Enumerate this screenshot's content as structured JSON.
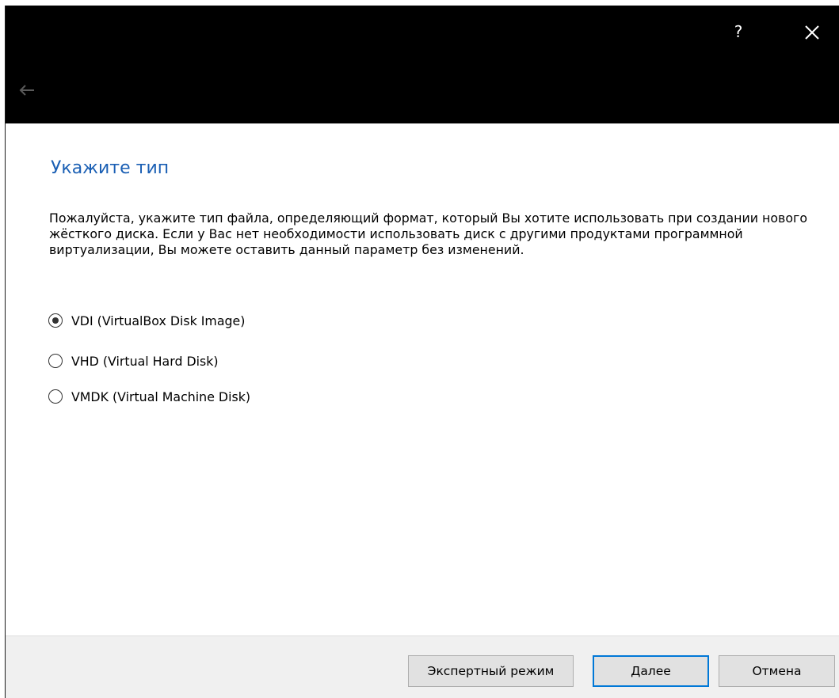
{
  "titlebar": {
    "help_label": "?",
    "close_icon": "close-icon",
    "back_icon": "back-arrow-icon"
  },
  "page": {
    "title": "Укажите тип",
    "description": "Пожалуйста, укажите тип файла, определяющий формат, который Вы хотите использовать при создании нового жёсткого диска. Если у Вас нет необходимости использовать диск с другими продуктами программной виртуализации, Вы можете оставить данный параметр без изменений."
  },
  "options": [
    {
      "label": "VDI (VirtualBox Disk Image)",
      "checked": true
    },
    {
      "label": "VHD (Virtual Hard Disk)",
      "checked": false
    },
    {
      "label": "VMDK (Virtual Machine Disk)",
      "checked": false
    }
  ],
  "footer": {
    "expert_label": "Экспертный режим",
    "next_label": "Далее",
    "cancel_label": "Отмена"
  },
  "colors": {
    "titlebar": "#000000",
    "title_text": "#1a5fb4",
    "footer": "#f0f0f0",
    "default_button_border": "#0078d7"
  }
}
